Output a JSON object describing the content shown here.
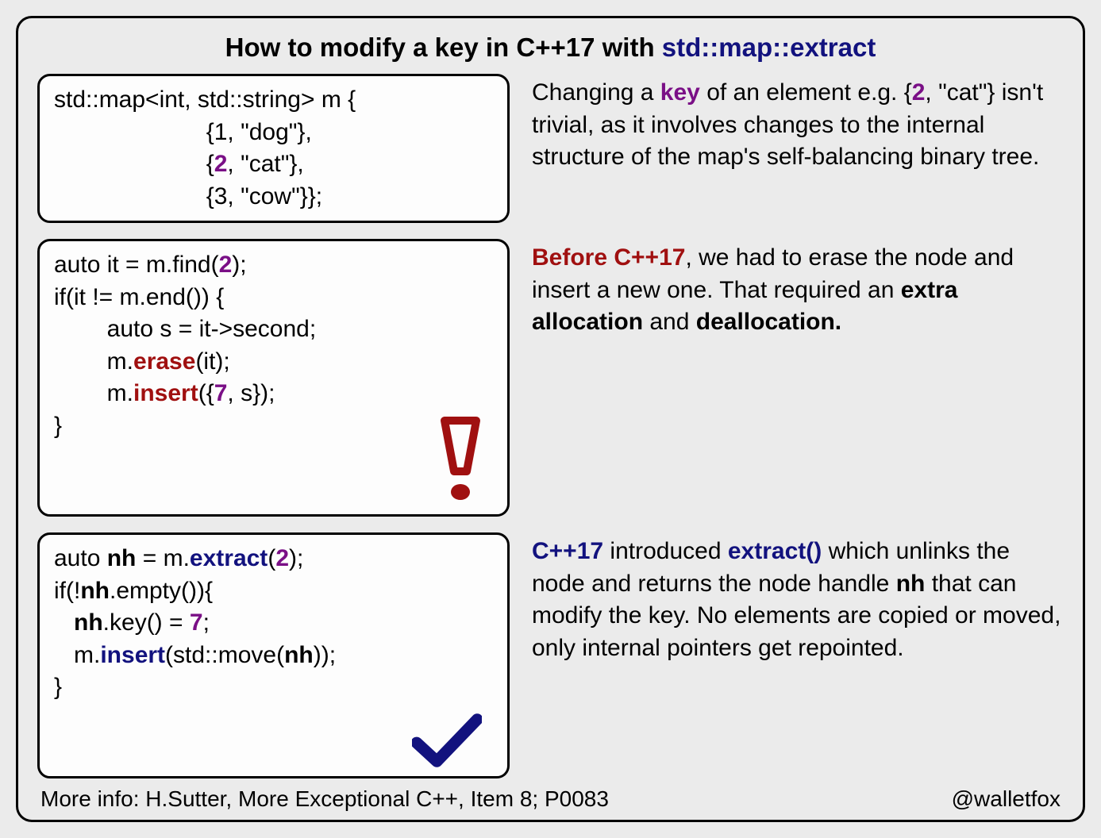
{
  "title": {
    "prefix": "How to modify a key in C++17 with ",
    "highlight": "std::map::extract"
  },
  "row1": {
    "code": {
      "l1a": "std::map<int, std::string> m {",
      "l2_pad": "                       {1, \"dog\"},",
      "l3_pad": "                       {",
      "l3_key": "2",
      "l3_end": ", \"cat\"},",
      "l4_pad": "                       {3, \"cow\"}};"
    },
    "desc": {
      "t1": "Changing a ",
      "key": "key",
      "t2": " of an element e.g. {",
      "two": "2",
      "t3": ", \"cat\"} isn't trivial, as it involves changes to the internal structure of the map's self-balancing binary tree."
    }
  },
  "row2": {
    "code": {
      "l1a": "auto it = m.find(",
      "l1_key": "2",
      "l1b": ");",
      "l2": "if(it != m.end()) {",
      "l3": "        auto s = it->second;",
      "l4a": "        m.",
      "l4_erase": "erase",
      "l4b": "(it);",
      "l5a": "        m.",
      "l5_insert": "insert",
      "l5b": "({",
      "l5_seven": "7",
      "l5c": ", s});",
      "l6": "}"
    },
    "desc": {
      "before": "Before C++17",
      "t1": ", we had to erase the node and insert a new one. That required an ",
      "extra": "extra allocation",
      "t2": " and ",
      "dealloc": "deallocation."
    }
  },
  "row3": {
    "code": {
      "l1a": "auto ",
      "l1_nh": "nh",
      "l1b": " = m.",
      "l1_extract": "extract",
      "l1c": "(",
      "l1_key": "2",
      "l1d": ");",
      "l2a": "if(!",
      "l2_nh": "nh",
      "l2b": ".empty()){",
      "l3a": "   ",
      "l3_nh": "nh",
      "l3b": ".key() = ",
      "l3_seven": "7",
      "l3c": ";",
      "l4a": "   m.",
      "l4_insert": "insert",
      "l4b": "(std::move(",
      "l4_nh": "nh",
      "l4c": "));",
      "l5": "}"
    },
    "desc": {
      "cpp17": "C++17",
      "t1": " introduced ",
      "extract": "extract()",
      "t2": " which unlinks the node and returns the node handle ",
      "nh": "nh",
      "t3": " that can modify the key. No elements are copied or moved, only internal pointers get repointed."
    }
  },
  "footer": {
    "left": "More info: H.Sutter, More Exceptional C++, Item 8; P0083",
    "right": "@walletfox"
  }
}
